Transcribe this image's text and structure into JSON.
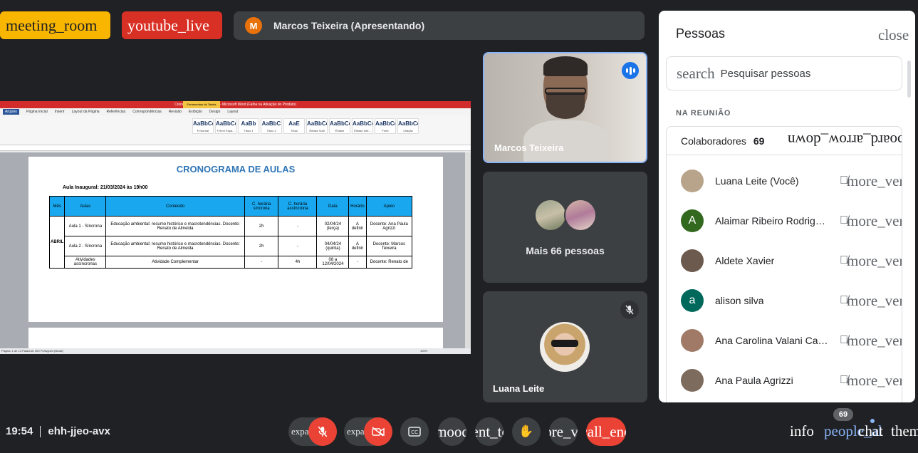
{
  "tags": {
    "meeting_room": "meeting_room",
    "youtube_live": "youtube_live"
  },
  "presenter": {
    "avatar_letter": "M",
    "label": "Marcos Teixeira (Apresentando)"
  },
  "shared_screen": {
    "window_title": "Cronograma Curso 2024 (1) - Microsoft Word (Falha na Ativação do Produto)",
    "table_tools": "Ferramentas de Tabela",
    "tabs": [
      "Arquivo",
      "Página Inicial",
      "Inserir",
      "Layout da Página",
      "Referências",
      "Correspondências",
      "Revisão",
      "Exibição",
      "Design",
      "Layout"
    ],
    "styles": [
      {
        "sample": "AaBbCcDd",
        "name": "¶ Normal"
      },
      {
        "sample": "AaBbCcDd",
        "name": "¶ Sem Espa..."
      },
      {
        "sample": "AaBb",
        "name": "Título 1"
      },
      {
        "sample": "AaBbC",
        "name": "Título 2"
      },
      {
        "sample": "AaE",
        "name": "Título"
      },
      {
        "sample": "AaBbCcDd",
        "name": "Ênfase Sutil"
      },
      {
        "sample": "AaBbCcDd",
        "name": "Ênfase"
      },
      {
        "sample": "AaBbCcDd",
        "name": "Ênfase Inte..."
      },
      {
        "sample": "AaBbCcDc",
        "name": "Forte"
      },
      {
        "sample": "AaBbCcDd",
        "name": "Citação"
      }
    ],
    "status_bar": "Página: 1 de 13   Palavras: 300   Português (Brasil)",
    "zoom": "100%",
    "doc_title": "CRONOGRAMA DE AULAS",
    "doc_subtitle": "Aula Inaugural: 21/03/2024 às 19h00",
    "table_headers": [
      "Mês",
      "Aulas",
      "Conteúdo",
      "C. horária síncrona",
      "C. horária assíncrona",
      "Data",
      "Horário",
      "Apoio"
    ],
    "month": "ABRIL",
    "rows": [
      [
        "Aula 1 - Síncrona",
        "Educação ambiental: resumo histórico e macrotendências. Docente: Renato de Almeida",
        "2h",
        "-",
        "02/04/24 (terça)",
        "A definir",
        "Docente: Ana Paula Agrizzi"
      ],
      [
        "Aula 2 - Síncrona",
        "Educação ambiental: resumo histórico e macrotendências. Docente: Renato de Almeida",
        "2h",
        "-",
        "04/04/24 (quinta)",
        "A definir",
        "Docente: Marcos Teixeira"
      ],
      [
        "Atividades assíncronas",
        "Atividade Complementar",
        "-",
        "4h",
        "08 a 12/04/2024",
        "-",
        "Docente: Renato de"
      ]
    ]
  },
  "tiles": {
    "main_name": "Marcos Teixeira",
    "more_label": "Mais 66 pessoas",
    "luana_name": "Luana Leite"
  },
  "people_panel": {
    "title": "Pessoas",
    "close_icon": "close",
    "search_icon": "search",
    "search_placeholder": "Pesquisar pessoas",
    "section_label": "NA REUNIÃO",
    "collab_label": "Colaboradores",
    "collab_count": "69",
    "arrow_icon": "keyboard_arrow_down",
    "more_icon": "more_vert",
    "participants": [
      {
        "name": "Luana Leite (Você)",
        "letter": "",
        "color": "#b8a48a"
      },
      {
        "name": "Alaimar Ribeiro Rodrigues",
        "letter": "A",
        "color": "#33691e"
      },
      {
        "name": "Aldete Xavier",
        "letter": "",
        "color": "#6d5a4e"
      },
      {
        "name": "alison silva",
        "letter": "a",
        "color": "#00695c"
      },
      {
        "name": "Ana Carolina Valani Carraro",
        "letter": "",
        "color": "#a07a66"
      },
      {
        "name": "Ana Paula Agrizzi",
        "letter": "",
        "color": "#7d6b5e"
      }
    ]
  },
  "bottom_bar": {
    "time": "19:54",
    "meeting_code": "ehh-jjeo-avx",
    "expand_label": "expand_less",
    "mood": "mood",
    "present": "present_to_all",
    "more": "more_vert",
    "call": "call_end",
    "info": "info",
    "people": "people_alt",
    "people_badge": "69",
    "chat": "chat",
    "themes": "themes"
  }
}
